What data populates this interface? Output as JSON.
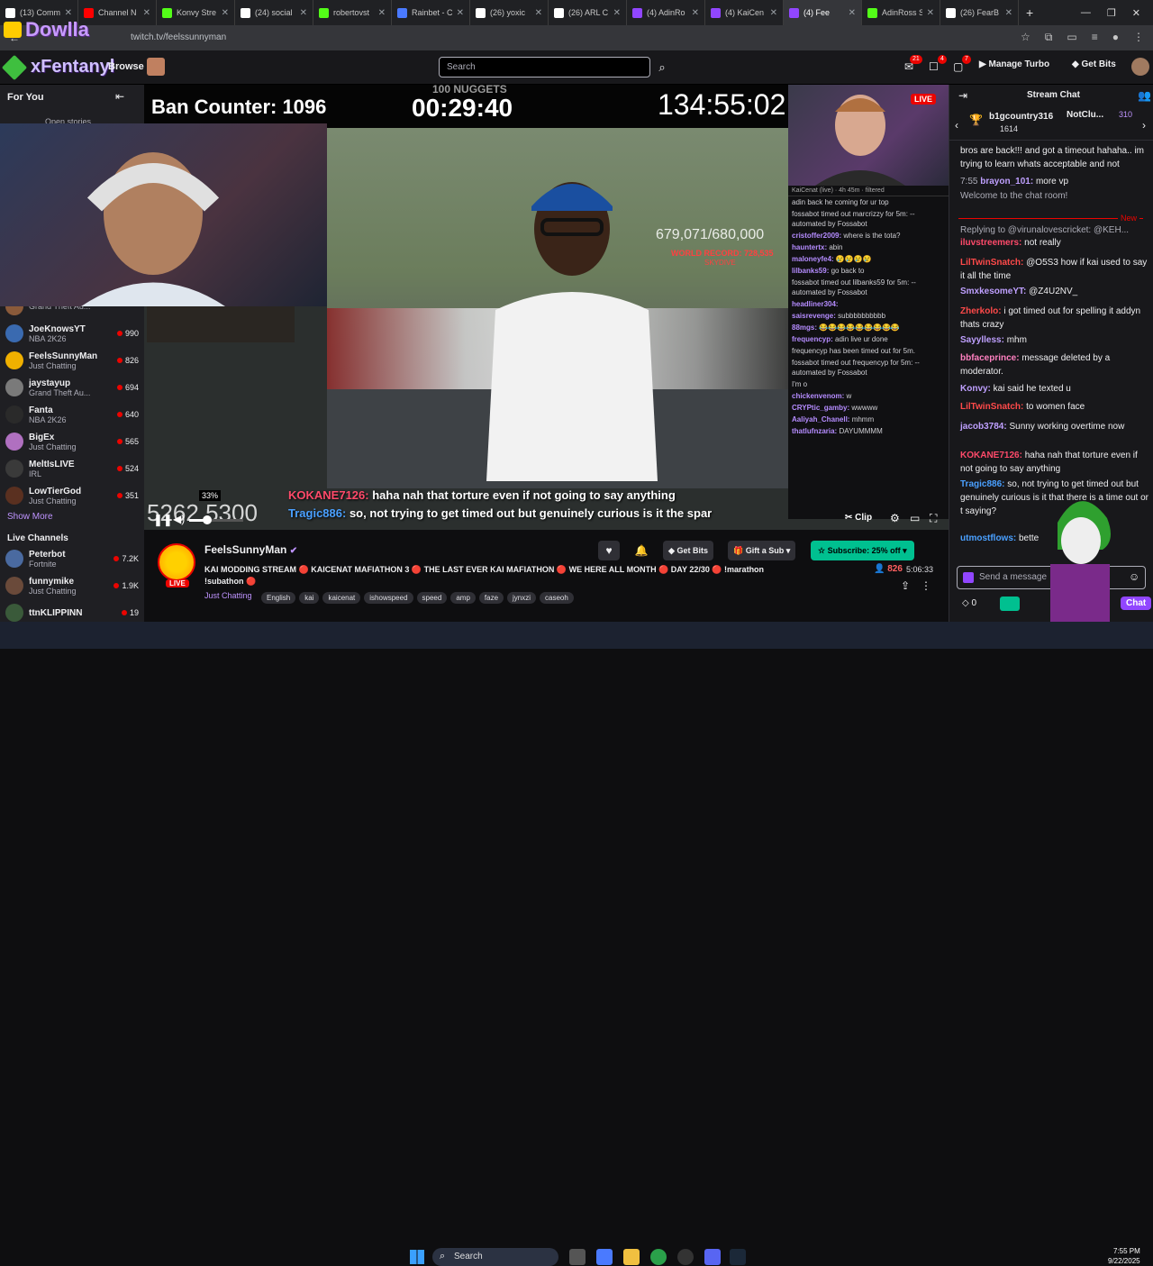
{
  "browser": {
    "tabs": [
      {
        "title": "(13) Comm",
        "color": "#ffffff",
        "icon": "x-icon"
      },
      {
        "title": "Channel N",
        "color": "#ff0000",
        "icon": "youtube-icon"
      },
      {
        "title": "Konvy Stre",
        "color": "#53fc18",
        "icon": "kick-icon"
      },
      {
        "title": "(24) social",
        "color": "#ffffff",
        "icon": "x-icon"
      },
      {
        "title": "robertovst",
        "color": "#53fc18",
        "icon": "kick-icon"
      },
      {
        "title": "Rainbet - C",
        "color": "#4a7aff",
        "icon": "rainbet-icon"
      },
      {
        "title": "(26) yoxic",
        "color": "#ffffff",
        "icon": "x-icon"
      },
      {
        "title": "(26) ARL C",
        "color": "#ffffff",
        "icon": "x-icon"
      },
      {
        "title": "(4) AdinRo",
        "color": "#9146ff",
        "icon": "twitch-icon"
      },
      {
        "title": "(4) KaiCen",
        "color": "#9146ff",
        "icon": "twitch-icon"
      },
      {
        "title": "(4) Fee",
        "color": "#9146ff",
        "icon": "twitch-icon"
      },
      {
        "title": "AdinRoss S",
        "color": "#53fc18",
        "icon": "kick-icon"
      },
      {
        "title": "(26) FearB",
        "color": "#ffffff",
        "icon": "x-icon"
      }
    ],
    "address": "twitch.tv/feelssunnyman",
    "overlay_logo_text": "Dowlla"
  },
  "topnav": {
    "logo_text": "xFentanyl",
    "browse_label": "Browse",
    "search_placeholder": "Search",
    "manage_turbo": "Manage Turbo",
    "get_bits": "Get Bits",
    "badges": [
      "21",
      "4",
      "7"
    ]
  },
  "sidebar": {
    "header": "For You",
    "open_stories": "Open stories",
    "followed": [
      {
        "name": "",
        "category": "Grand Theft Au...",
        "viewers": "",
        "color": "#8a5a3a"
      },
      {
        "name": "JoeKnowsYT",
        "category": "NBA 2K26",
        "viewers": "990",
        "color": "#3a6ab0"
      },
      {
        "name": "FeelsSunnyMan",
        "category": "Just Chatting",
        "viewers": "826",
        "color": "#f0b000"
      },
      {
        "name": "jaystayup",
        "category": "Grand Theft Au...",
        "viewers": "694",
        "color": "#7a7a7a"
      },
      {
        "name": "Fanta",
        "category": "NBA 2K26",
        "viewers": "640",
        "color": "#2a2a2a"
      },
      {
        "name": "BigEx",
        "category": "Just Chatting",
        "viewers": "565",
        "color": "#b070c0"
      },
      {
        "name": "MeltIsLIVE",
        "category": "IRL",
        "viewers": "524",
        "color": "#3a3a3a"
      },
      {
        "name": "LowTierGod",
        "category": "Just Chatting",
        "viewers": "351",
        "color": "#5a3020"
      }
    ],
    "show_more": "Show More",
    "live_header": "Live Channels",
    "live": [
      {
        "name": "Peterbot",
        "category": "Fortnite",
        "viewers": "7.2K",
        "color": "#4a6aa0"
      },
      {
        "name": "funnymike",
        "category": "Just Chatting",
        "viewers": "1.9K",
        "color": "#6a4a3a"
      },
      {
        "name": "ttnKLIPPINN",
        "category": "",
        "viewers": "19",
        "color": "#3a5a3a"
      }
    ]
  },
  "video": {
    "ban_counter": "Ban Counter: 1096",
    "nuggets_label": "100 NUGGETS",
    "timer": "00:29:40",
    "total_timer": "134:55:02",
    "subs_count": "679,071/680,000",
    "world_record": "WORLD RECORD: 728,535",
    "skydive": "SKYDIVE",
    "bottom_counter": "5262 5300",
    "volume_tooltip": "33%",
    "volume_level": 0.33,
    "live_badge": "LIVE",
    "clip_label": "Clip",
    "overlay_chat": [
      {
        "user": "KOKANE7126:",
        "text": "haha nah that torture even if not going to say anything",
        "color": "#ff4a6a"
      },
      {
        "user": "Tragic886:",
        "text": "so, not trying to get timed out but genuinely curious is it the spar",
        "color": "#4aa0ff"
      }
    ],
    "inner_chat_header": "KaiCenat (live) · 4h 45m · filtered",
    "inner_chat": [
      {
        "user": "",
        "text": "adin back he coming for ur top"
      },
      {
        "user": "",
        "text": "fossabot timed out marcrizzy for 5m: -- automated by Fossabot"
      },
      {
        "user": "cristoffer2009:",
        "text": "where is the tota?"
      },
      {
        "user": "hauntertx:",
        "text": "abin"
      },
      {
        "user": "maloneyfe4:",
        "text": "😢😢😢😢"
      },
      {
        "user": "lilbanks59:",
        "text": "go back to"
      },
      {
        "user": "",
        "text": "fossabot timed out lilbanks59 for 5m: -- automated by Fossabot"
      },
      {
        "user": "headliner304:",
        "text": ""
      },
      {
        "user": "saisrevenge:",
        "text": "subbbbbbbbbb"
      },
      {
        "user": "88mgs:",
        "text": "😂😂😂😂😂😂😂😂😂"
      },
      {
        "user": "frequencyp:",
        "text": "adin live ur done"
      },
      {
        "user": "",
        "text": "frequencyp has been timed out for 5m."
      },
      {
        "user": "",
        "text": "fossabot timed out frequencyp for 5m: -- automated by Fossabot"
      },
      {
        "user": "",
        "text": "I'm o"
      },
      {
        "user": "chickenvenom:",
        "text": "w"
      },
      {
        "user": "CRYPtic_gamby:",
        "text": "wwwww"
      },
      {
        "user": "Aaliyah_Chanell:",
        "text": "mhmm"
      },
      {
        "user": "thatlufnzaria:",
        "text": "DAYUMMMM"
      }
    ],
    "right_cam_live": "LIVE"
  },
  "stream_info": {
    "channel": "FeelsSunnyMan",
    "title": "KAI MODDING STREAM 🔴 KAICENAT MAFIATHON 3 🔴 THE LAST EVER KAI MAFIATHON 🔴 WE HERE ALL MONTH 🔴 DAY 22/30 🔴 !marathon",
    "title_line2": "!subathon 🔴",
    "category": "Just Chatting",
    "tags": [
      "English",
      "kai",
      "kaicenat",
      "ishowspeed",
      "speed",
      "amp",
      "faze",
      "jynxzi",
      "caseoh"
    ],
    "viewers": "826",
    "uptime": "5:06:33",
    "get_bits": "Get Bits",
    "gift_sub": "Gift a Sub",
    "subscribe": "Subscribe: 25% off",
    "live": "LIVE"
  },
  "chat": {
    "title": "Stream Chat",
    "pinned": [
      {
        "name": "b1gcountry316",
        "count": "1614"
      },
      {
        "name": "NotClu...",
        "count": "310"
      }
    ],
    "messages": [
      {
        "user": "",
        "text": "bros are back!!! and got a timeout hahaha.. im trying to learn whats acceptable and not",
        "color": "#efeff1"
      },
      {
        "user": "brayon_101:",
        "text": "more vp",
        "prefix": "7:55",
        "color": "#bfa0ff"
      },
      {
        "user": "",
        "text": "Welcome to the chat room!",
        "color": "#adadb8"
      },
      {
        "user": "",
        "text": "Replying to @virunalovescricket: @KEH...",
        "color": "#adadb8"
      },
      {
        "user": "iluvstreemers:",
        "text": "not really",
        "color": "#ff4a6a"
      },
      {
        "user": "LilTwinSnatch:",
        "text": "@O5S3 how if kai used to say it all the time",
        "color": "#ff4a4a"
      },
      {
        "user": "SmxkesomeYT:",
        "text": "@Z4U2NV_",
        "color": "#bfa0ff"
      },
      {
        "user": "Zherkolo:",
        "text": "i got timed out for spelling it addyn thats crazy",
        "color": "#ff4a4a"
      },
      {
        "user": "Sayylless:",
        "text": "mhm",
        "color": "#bfa0ff"
      },
      {
        "user": "bbfaceprince:",
        "text": "message deleted by a moderator.",
        "color": "#ff80c0"
      },
      {
        "user": "Konvy:",
        "text": "kai said he texted u",
        "color": "#bfa0ff"
      },
      {
        "user": "LilTwinSnatch:",
        "text": "to women face",
        "color": "#ff4a4a"
      },
      {
        "user": "jacob3784:",
        "text": "Sunny working overtime now",
        "color": "#bfa0ff"
      },
      {
        "user": "KOKANE7126:",
        "text": "haha nah that torture even if not going to say anything",
        "color": "#ff4a6a"
      },
      {
        "user": "Tragic886:",
        "text": "so, not trying to get timed out but genuinely curious is it that there is a time out or t saying?",
        "color": "#4aa0ff"
      },
      {
        "user": "utmostflows:",
        "text": "bette",
        "color": "#4aa0ff"
      }
    ],
    "new_label": "New",
    "input_placeholder": "Send a message",
    "points": "0",
    "chat_button": "Chat"
  },
  "taskbar": {
    "search": "Search",
    "time": "7:55 PM",
    "date": "9/22/2025"
  }
}
